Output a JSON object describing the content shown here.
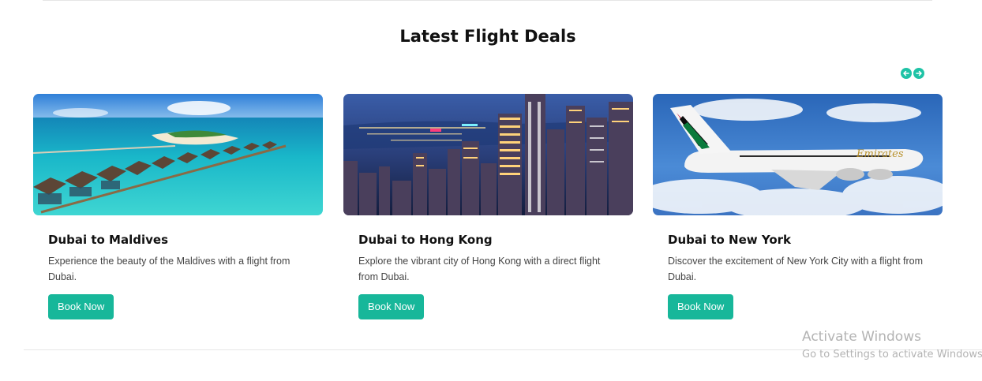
{
  "section": {
    "title": "Latest Flight Deals"
  },
  "carousel": {
    "prev_icon": "arrow-left-icon",
    "next_icon": "arrow-right-icon",
    "accent": "#1fc3a6"
  },
  "deals": [
    {
      "image": "maldives-resort-photo",
      "title": "Dubai to Maldives",
      "description": "Experience the beauty of the Maldives with a flight from Dubai.",
      "button": "Book Now"
    },
    {
      "image": "hong-kong-skyline-photo",
      "title": "Dubai to Hong Kong",
      "description": "Explore the vibrant city of Hong Kong with a direct flight from Dubai.",
      "button": "Book Now"
    },
    {
      "image": "emirates-airplane-photo",
      "title": "Dubai to New York",
      "description": "Discover the excitement of New York City with a flight from Dubai.",
      "button": "Book Now"
    }
  ],
  "button_color": "#17b79a",
  "watermark": {
    "title": "Activate Windows",
    "subtitle": "Go to Settings to activate Windows"
  }
}
